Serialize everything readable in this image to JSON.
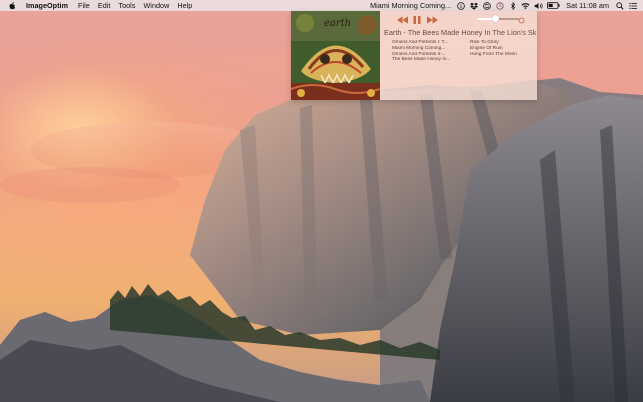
{
  "menubar": {
    "app_name": "ImageOptim",
    "menus": [
      "File",
      "Edit",
      "Tools",
      "Window",
      "Help"
    ],
    "now_playing": "Miami Morning Coming...",
    "clock": "Sat 11:08 am"
  },
  "player": {
    "album_title": "Earth - The Bees Made Honey In The Lion's Skull",
    "album_art_text": "earth",
    "volume_level": 0.42,
    "tracks_left": [
      "Omens And Portents I: T...",
      "Miami Morning Coming...",
      "Omens And Portents II:...",
      "The Bees Made Honey In..."
    ],
    "tracks_right": [
      "Rise To Glory",
      "Engine Of Ruin",
      "Hung From The Moon"
    ]
  },
  "icons": {
    "apple": "apple-logo-icon",
    "prev": "rewind-icon",
    "pause": "pause-icon",
    "next": "fast-forward-icon",
    "volume_max": "volume-max-icon"
  },
  "colors": {
    "title_text": "#6e4a3c",
    "transport": "#c8693e",
    "menubar_bg": "#ece8ea"
  }
}
